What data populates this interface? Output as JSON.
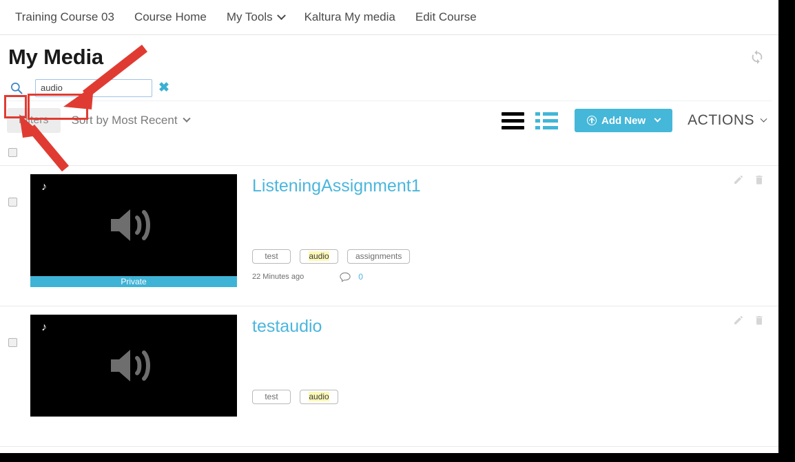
{
  "topnav": {
    "items": [
      {
        "label": "Training Course 03",
        "has_caret": false
      },
      {
        "label": "Course Home",
        "has_caret": false
      },
      {
        "label": "My Tools",
        "has_caret": true
      },
      {
        "label": "Kaltura My media",
        "has_caret": false
      },
      {
        "label": "Edit Course",
        "has_caret": false
      }
    ]
  },
  "header": {
    "title": "My Media",
    "refresh_icon": "refresh-icon"
  },
  "search": {
    "icon": "search-icon",
    "value": "audio",
    "placeholder": "",
    "clear_label": "✖"
  },
  "toolbar": {
    "filters_label": "Filters",
    "sort_label": "Sort by Most Recent",
    "table_view_icon": "hamburger-view-icon",
    "list_view_icon": "list-view-icon",
    "add_new_label": "Add New",
    "add_new_icon": "upload-circle-icon",
    "actions_label": "ACTIONS"
  },
  "colors": {
    "accent_teal": "#45b7d9",
    "link_blue": "#4bb6dd",
    "annotation_red": "#e03b32",
    "highlight_yellow": "#fcf8b6",
    "filters_bg": "#ececec"
  },
  "media_items": [
    {
      "title": "ListeningAssignment1",
      "privacy": "Private",
      "thumb_icon": "audio-speaker-icon",
      "badge_icon": "music-note-icon",
      "tags": [
        {
          "text": "test",
          "highlight": ""
        },
        {
          "text": "audio",
          "highlight": "audio"
        },
        {
          "text": "assignments",
          "highlight": ""
        }
      ],
      "timestamp": "22 Minutes ago",
      "comment_count": "0",
      "edit_icon": "pencil-icon",
      "delete_icon": "trash-icon"
    },
    {
      "title": "testaudio",
      "privacy": "",
      "thumb_icon": "audio-speaker-icon",
      "badge_icon": "music-note-icon",
      "tags": [
        {
          "text": "test",
          "highlight": ""
        },
        {
          "text": "audio",
          "highlight": "audio"
        }
      ],
      "timestamp": "",
      "comment_count": "",
      "edit_icon": "pencil-icon",
      "delete_icon": "trash-icon"
    }
  ]
}
